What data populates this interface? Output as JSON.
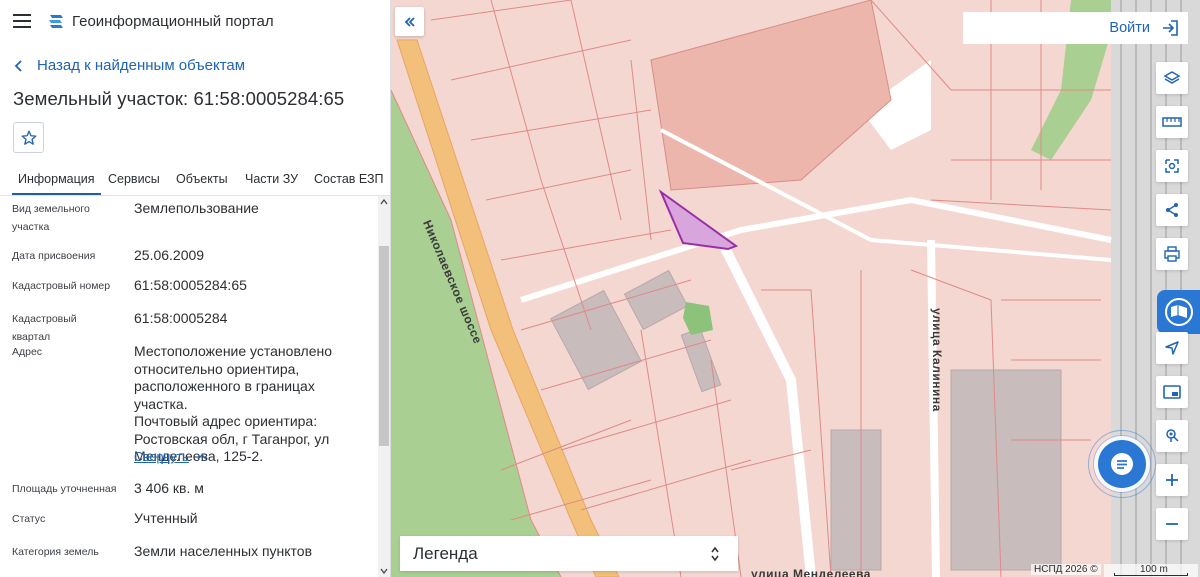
{
  "header": {
    "app_title": "Геоинформационный портал",
    "menu_icon": "hamburger-icon",
    "logo_icon": "portal-logo-icon"
  },
  "back_link": {
    "label": "Назад к найденным объектам"
  },
  "parcel": {
    "title": "Земельный участок: 61:58:0005284:65"
  },
  "tabs": [
    {
      "label": "Информация",
      "active": true
    },
    {
      "label": "Сервисы"
    },
    {
      "label": "Объекты"
    },
    {
      "label": "Части ЗУ"
    },
    {
      "label": "Состав ЕЗП"
    }
  ],
  "info": {
    "land_type": {
      "label": "Вид земельного участка",
      "value": "Землепользование"
    },
    "assigned_date": {
      "label": "Дата присвоения",
      "value": "25.06.2009"
    },
    "cadastral_number": {
      "label": "Кадастровый номер",
      "value": "61:58:0005284:65"
    },
    "cadastral_block": {
      "label": "Кадастровый квартал",
      "value": "61:58:0005284"
    },
    "address": {
      "label": "Адрес",
      "value_lines": [
        "Местоположение установлено",
        "относительно ориентира,",
        "расположенного в границах участка.",
        "Почтовый адрес ориентира:",
        "Ростовская обл, г Таганрог, ул",
        "Менделеева, 125-2."
      ]
    },
    "collapse_label": "Свернуть",
    "area": {
      "label": "Площадь уточненная",
      "value": "3 406 кв. м"
    },
    "status": {
      "label": "Статус",
      "value": "Учтенный"
    },
    "land_category": {
      "label": "Категория земель",
      "value": "Земли населенных пунктов"
    }
  },
  "map": {
    "login_label": "Войти",
    "legend_label": "Легенда",
    "copyright": "НСПД 2026 ©",
    "scale_label": "100 m",
    "street_labels": [
      "Николаевское шоссе",
      "улица Калинина",
      "улица Менделеева"
    ],
    "tools": [
      "layers-icon",
      "ruler-icon",
      "select-area-icon",
      "share-icon",
      "print-icon",
      "map-overlay-icon",
      "locate-icon",
      "screen-icon",
      "place-search-icon",
      "zoom-in-icon",
      "zoom-out-icon"
    ],
    "colors": {
      "parcel_fill": "#f2cfc8",
      "parcel_border": "#e08a86",
      "selected_fill": "#d8a6dc",
      "selected_border": "#9a2ea8",
      "green": "#9ec88a",
      "road": "#f2c07a",
      "accent": "#2a78d4"
    }
  }
}
